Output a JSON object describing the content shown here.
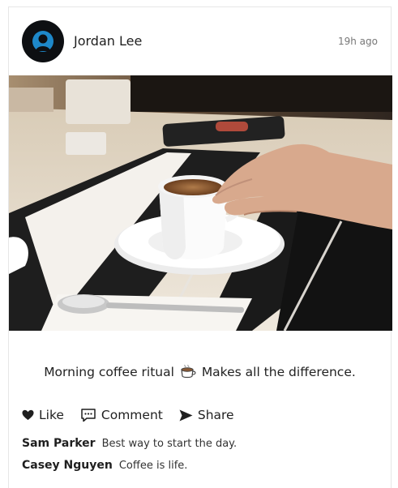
{
  "post": {
    "author": "Jordan Lee",
    "time": "19h ago",
    "caption_before": "Morning coffee ritual",
    "caption_after": "Makes all the difference."
  },
  "actions": {
    "like": "Like",
    "comment": "Comment",
    "share": "Share"
  },
  "comments": [
    {
      "author": "Sam Parker",
      "text": "Best way to start the day."
    },
    {
      "author": "Casey Nguyen",
      "text": "Coffee is life."
    }
  ],
  "icons": [
    "avatar-silhouette-icon",
    "coffee-cup-icon",
    "heart-icon",
    "comment-icon",
    "share-icon"
  ]
}
